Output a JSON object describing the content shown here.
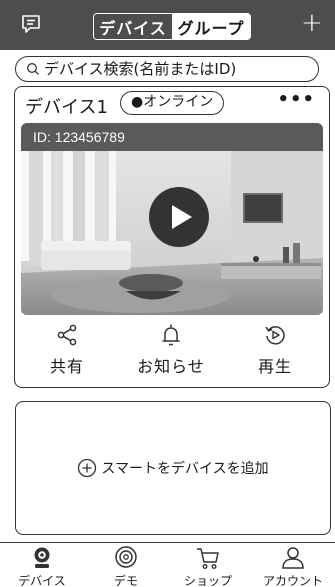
{
  "header": {
    "tabs": [
      {
        "label": "デバイス",
        "active": true
      },
      {
        "label": "グループ",
        "active": false
      }
    ],
    "add_icon": "plus-icon",
    "menu_icon": "chat-menu-icon",
    "accent_color": "#4d4d4d"
  },
  "search": {
    "placeholder": "デバイス検索(名前またはID)",
    "icon": "search-icon"
  },
  "device": {
    "name": "デバイス1",
    "status": "●オンライン",
    "more": "•••",
    "id_label": "ID: 123456789",
    "actions": [
      {
        "label": "共有",
        "icon": "share-icon"
      },
      {
        "label": "お知らせ",
        "icon": "bell-icon"
      },
      {
        "label": "再生",
        "icon": "playback-icon"
      }
    ]
  },
  "add_device": {
    "label": "スマートをデバイスを追加",
    "icon": "plus-circle-icon"
  },
  "bottom_nav": [
    {
      "label": "デバイス",
      "icon": "camera-icon",
      "active": true
    },
    {
      "label": "デモ",
      "icon": "demo-icon",
      "active": false
    },
    {
      "label": "ショップ",
      "icon": "cart-icon",
      "active": false
    },
    {
      "label": "アカウント",
      "icon": "person-icon",
      "active": false
    }
  ]
}
